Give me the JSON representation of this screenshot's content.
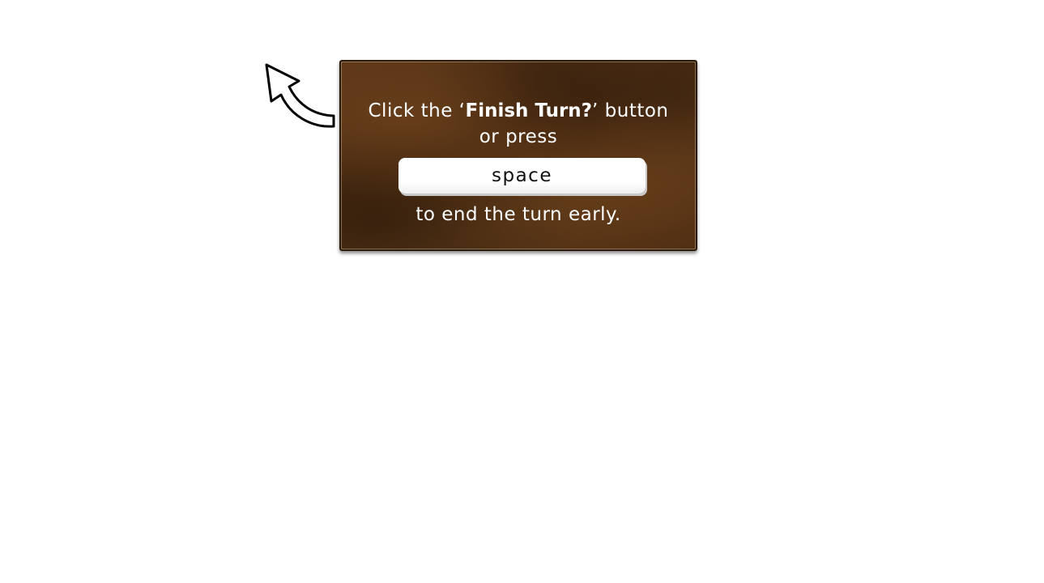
{
  "tutorial_tip": {
    "prefix": "Click the ‘",
    "button_name": "Finish Turn?",
    "suffix": "’ button",
    "line2": "or press",
    "key_label": "space",
    "line3": "to end the turn early."
  },
  "icons": {
    "pointer_arrow": "curved-arrow-up-left-icon"
  },
  "colors": {
    "panel_brown": "#4f2f14",
    "panel_border": "#2a1a0c",
    "text": "#ffffff",
    "key_bg": "#ffffff",
    "key_text": "#111111"
  }
}
